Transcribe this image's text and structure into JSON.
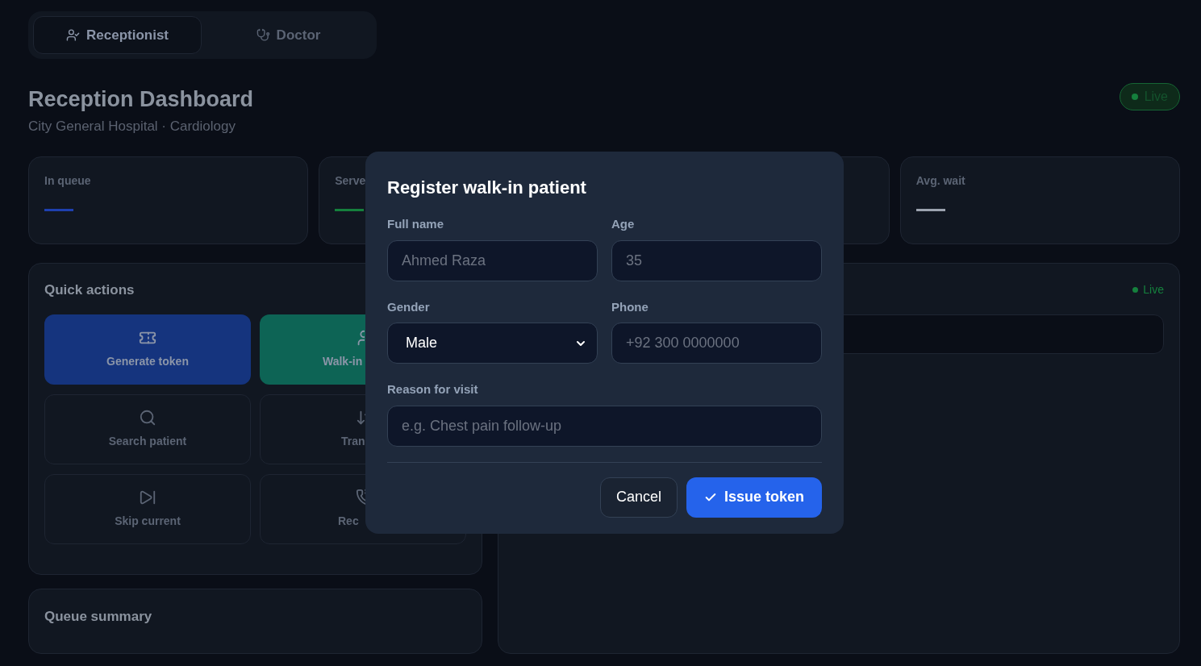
{
  "role_tabs": [
    {
      "label": "Receptionist",
      "selected": true
    },
    {
      "label": "Doctor",
      "selected": false
    }
  ],
  "header": {
    "title": "Reception Dashboard",
    "subtitle": "City General Hospital · Cardiology",
    "status": "Live"
  },
  "stats": [
    {
      "label": "In queue",
      "color": "#1e40af"
    },
    {
      "label": "Serve",
      "color": "#15803d"
    },
    {
      "label": "Avg. wait",
      "color": "#9ca3af"
    }
  ],
  "quick_actions": {
    "title": "Quick actions",
    "items": [
      {
        "label": "Generate token",
        "kind": "primary"
      },
      {
        "label": "Walk-in",
        "kind": "accent"
      },
      {
        "label": "Search patient",
        "kind": "plain"
      },
      {
        "label": "Tran",
        "kind": "plain"
      },
      {
        "label": "Skip current",
        "kind": "plain"
      },
      {
        "label": "Rec",
        "kind": "plain"
      }
    ]
  },
  "queue_summary": {
    "title": "Queue summary"
  },
  "live_panel": {
    "status": "Live"
  },
  "dialog": {
    "title": "Register walk-in patient",
    "fields": [
      {
        "label": "Full name",
        "kind": "text",
        "placeholder": "Ahmed Raza"
      },
      {
        "label": "Age",
        "kind": "text",
        "placeholder": "35"
      },
      {
        "label": "Gender",
        "kind": "select",
        "value": "Male"
      },
      {
        "label": "Phone",
        "kind": "text",
        "placeholder": "+92 300 0000000"
      },
      {
        "label": "Reason for visit",
        "kind": "text",
        "placeholder": "e.g. Chest pain follow-up"
      }
    ],
    "buttons": [
      {
        "label": "Cancel",
        "kind": "secondary"
      },
      {
        "label": "Issue token",
        "kind": "primary"
      }
    ]
  }
}
